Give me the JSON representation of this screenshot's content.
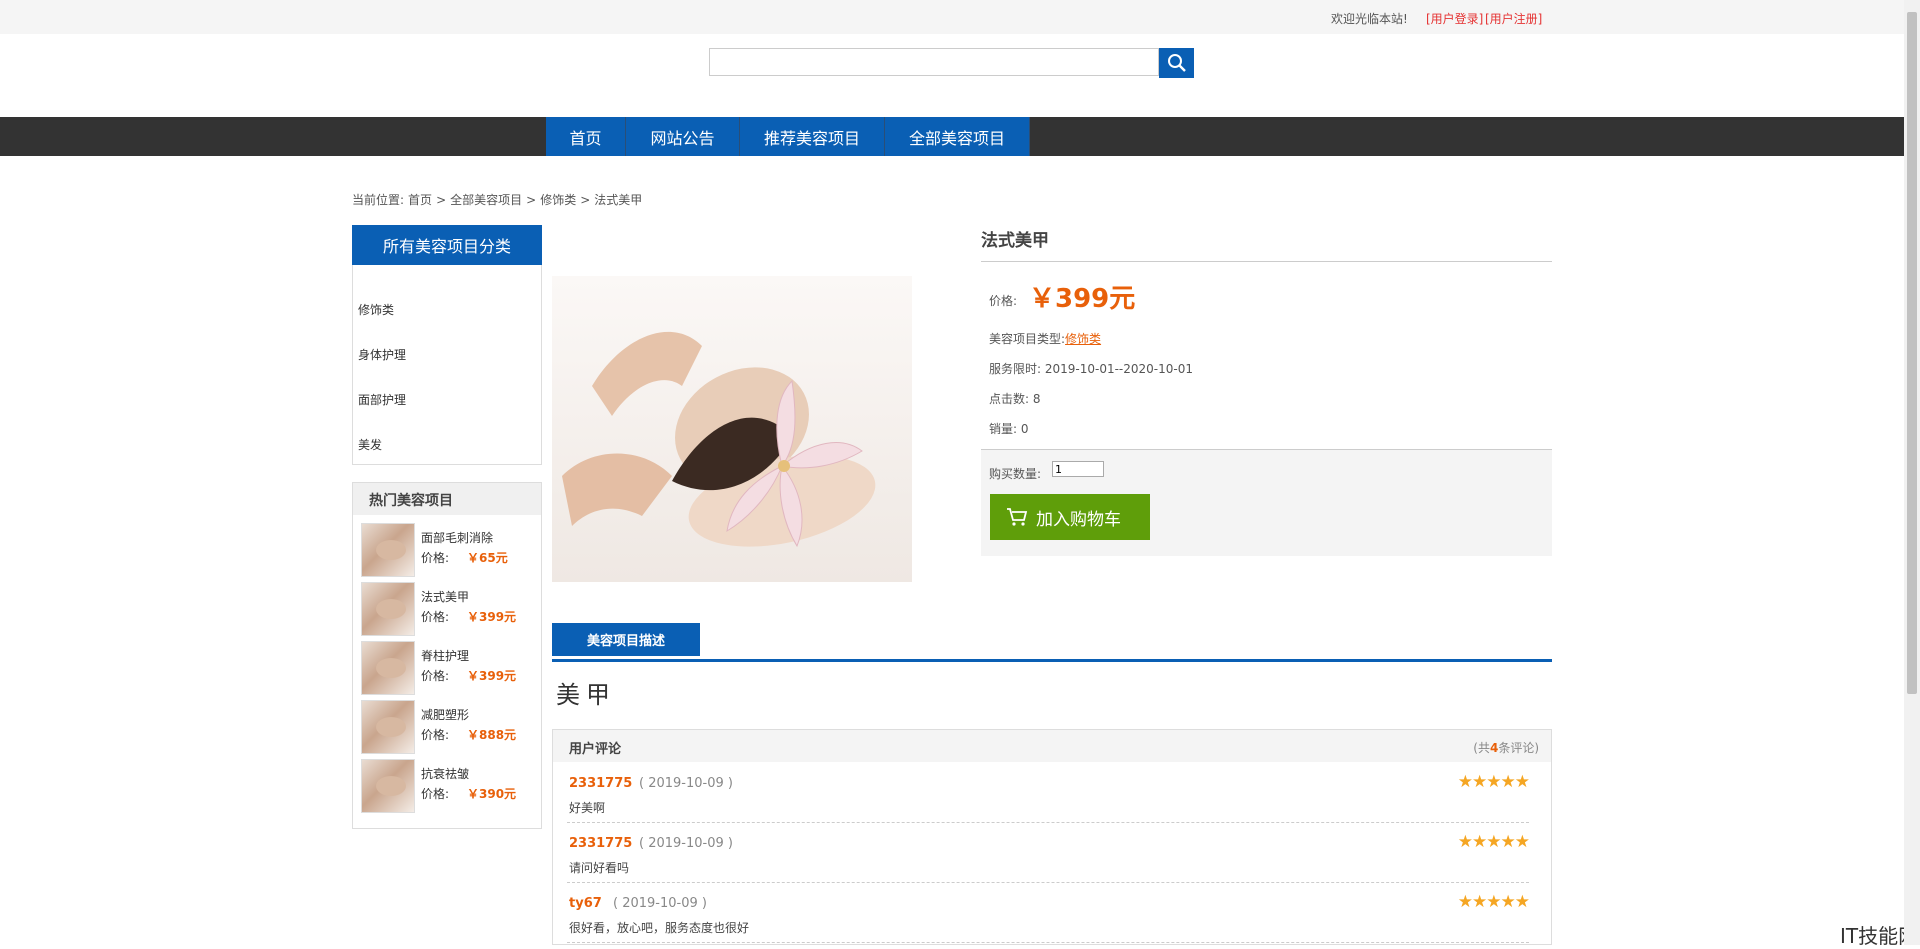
{
  "topbar": {
    "welcome": "欢迎光临本站!",
    "login": "[用户登录]",
    "register": "[用户注册]"
  },
  "search": {
    "placeholder": "",
    "button_icon": "search-icon"
  },
  "nav": {
    "items": [
      "首页",
      "网站公告",
      "推荐美容项目",
      "全部美容项目"
    ]
  },
  "breadcrumb": {
    "prefix": "当前位置:",
    "items": [
      "首页",
      "全部美容项目",
      "修饰类",
      "法式美甲"
    ],
    "separator": ">"
  },
  "sidebar": {
    "title": "所有美容项目分类",
    "categories": [
      "修饰类",
      "身体护理",
      "面部护理",
      "美发"
    ]
  },
  "hot": {
    "title": "热门美容项目",
    "price_label": "价格:",
    "items": [
      {
        "name": "面部毛刺消除",
        "price": "￥65元"
      },
      {
        "name": "法式美甲",
        "price": "￥399元"
      },
      {
        "name": "脊柱护理",
        "price": "￥399元"
      },
      {
        "name": "减肥塑形",
        "price": "￥888元"
      },
      {
        "name": "抗衰祛皱",
        "price": "￥390元"
      }
    ]
  },
  "product": {
    "title": "法式美甲",
    "price_label": "价格:",
    "price": "￥399元",
    "type_label": "美容项目类型:",
    "type_value": "修饰类",
    "service_period": "服务限时: 2019-10-01--2020-10-01",
    "clicks": "点击数: 8",
    "sales": "销量: 0",
    "qty_label": "购买数量:",
    "qty_value": "1",
    "cart_button": "加入购物车"
  },
  "tabs": {
    "active": "美容项目描述"
  },
  "description": "美甲",
  "reviews": {
    "title": "用户评论",
    "count_prefix": "(共",
    "count": "4",
    "count_suffix": "条评论)",
    "items": [
      {
        "user": "2331775",
        "date": "( 2019-10-09 )",
        "text": "好美啊",
        "stars": "★★★★★"
      },
      {
        "user": "2331775",
        "date": "( 2019-10-09 )",
        "text": "请问好看吗",
        "stars": "★★★★★"
      },
      {
        "user": "ty67",
        "date": "( 2019-10-09 )",
        "text": "很好看，放心吧，服务态度也很好",
        "stars": "★★★★★"
      }
    ]
  },
  "watermark": "IT技能网",
  "colors": {
    "primary": "#0a5fb4",
    "accent": "#e8600a",
    "cart": "#5f9e0a",
    "navbar": "#333333"
  }
}
